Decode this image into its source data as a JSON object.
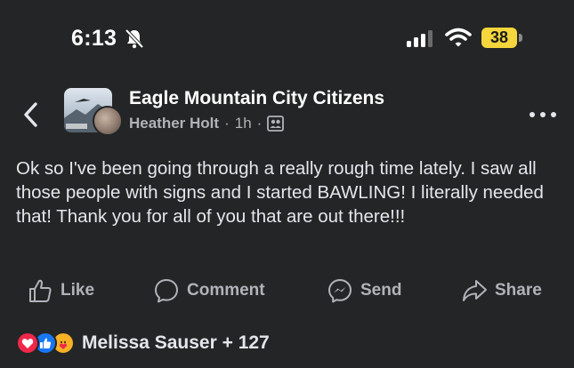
{
  "status_bar": {
    "time": "6:13",
    "battery": "38",
    "colors": {
      "battery": "#f5d63d"
    }
  },
  "post": {
    "group_name": "Eagle Mountain City Citizens",
    "author": "Heather Holt",
    "separator": "·",
    "time_ago": "1h",
    "privacy_icon": "members-icon",
    "text": "Ok so I've been going through a really rough time lately. I saw all those people with signs and I started BAWLING! I literally needed that! Thank you for all of you that are out there!!!"
  },
  "actions": {
    "like": "Like",
    "comment": "Comment",
    "send": "Send",
    "share": "Share"
  },
  "reactions": {
    "icons": [
      "love-reaction-icon",
      "like-reaction-icon",
      "care-reaction-icon"
    ],
    "summary": "Melissa Sauser + 127"
  },
  "colors": {
    "background": "#242526",
    "primary_text": "#e4e6eb",
    "secondary_text": "#b0b3b8",
    "love": "#f0284a",
    "like": "#1877f2",
    "care": "#f7b125"
  }
}
